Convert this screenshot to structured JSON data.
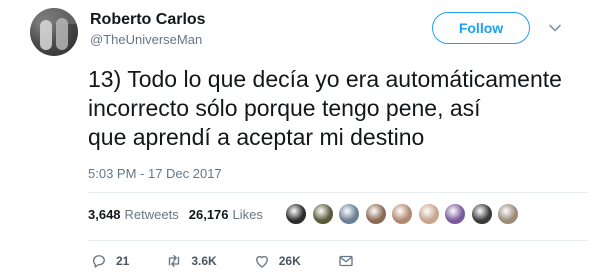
{
  "user": {
    "name": "Roberto Carlos",
    "handle": "@TheUniverseMan"
  },
  "follow_label": "Follow",
  "tweet": {
    "text": "13) Todo lo que decía yo era automáticamente\nincorrecto sólo porque tengo pene, así\nque aprendí a aceptar mi destino",
    "timestamp": "5:03 PM - 17 Dec 2017"
  },
  "stats": {
    "retweets_count": "3,648",
    "retweets_label": "Retweets",
    "likes_count": "26,176",
    "likes_label": "Likes"
  },
  "likers_colors": [
    "#2b2b2b",
    "#5a5a3a",
    "#6b7f95",
    "#8a6a55",
    "#b08a70",
    "#c7a58e",
    "#7a5a9a",
    "#3a3a3a",
    "#9a8a78"
  ],
  "actions": {
    "reply_count": "21",
    "retweet_count": "3.6K",
    "like_count": "26K"
  },
  "colors": {
    "accent": "#1da1f2",
    "secondary_text": "#657786",
    "primary_text": "#14171a"
  }
}
